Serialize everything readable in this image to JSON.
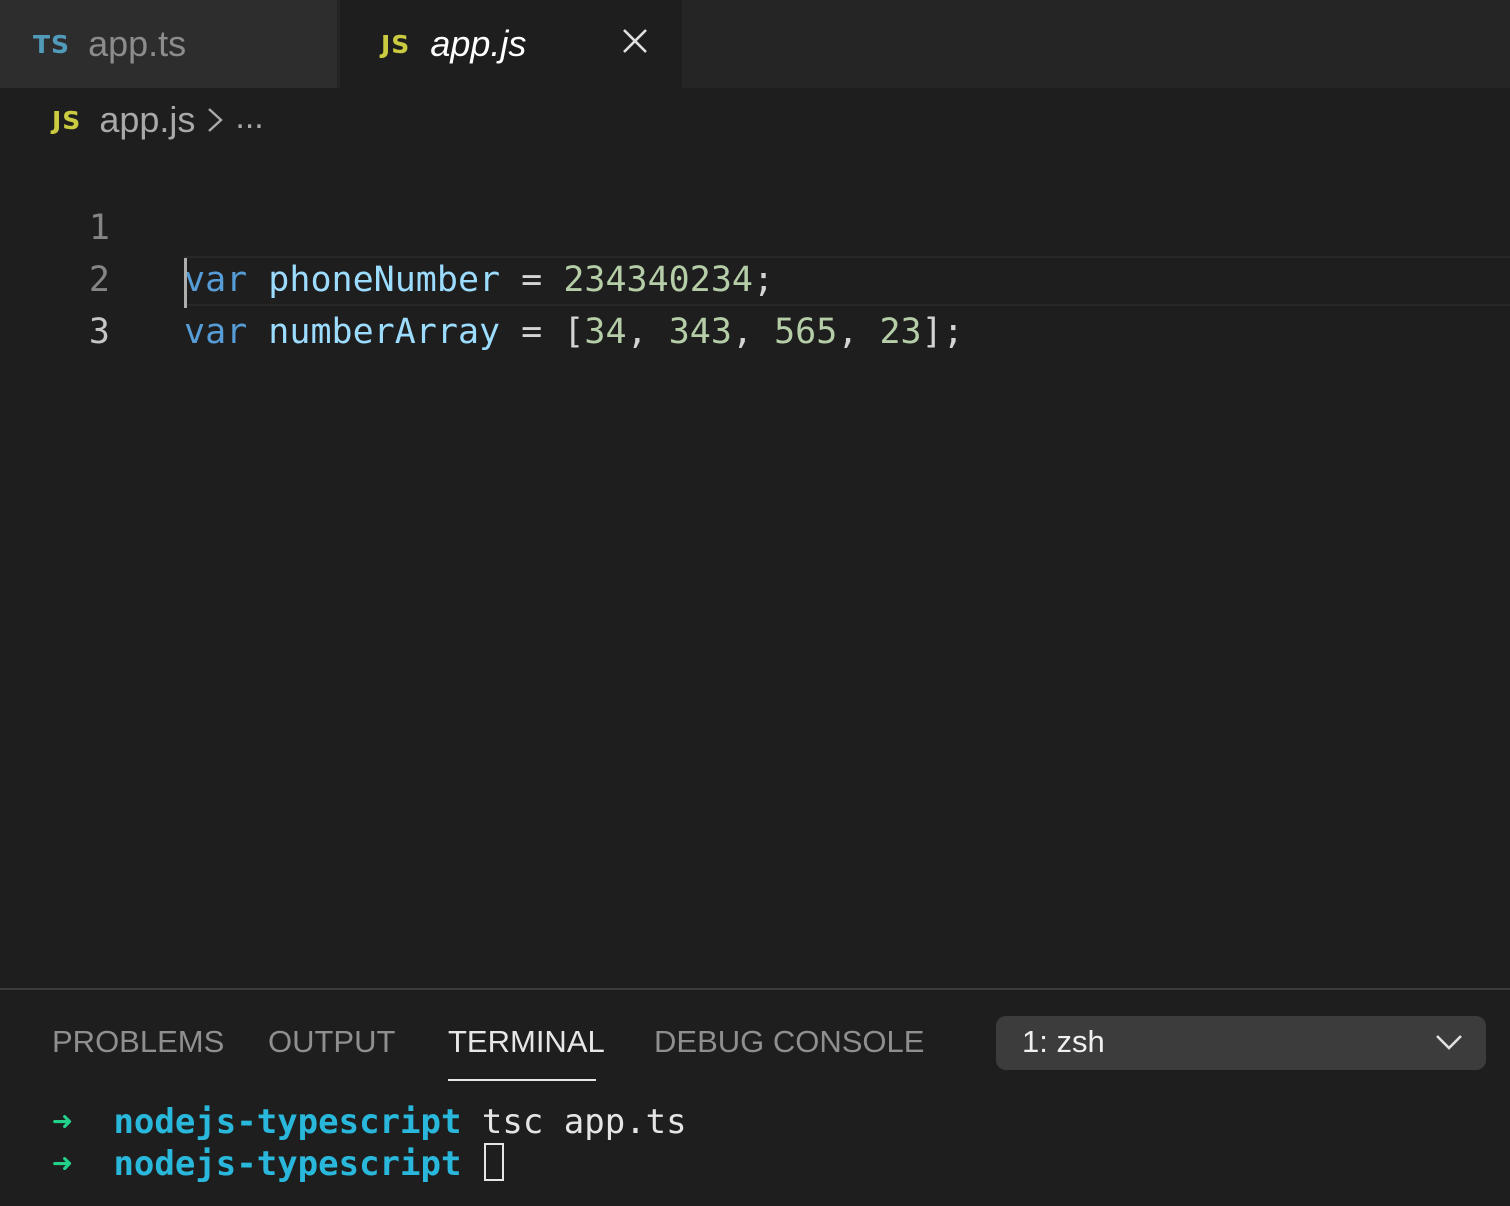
{
  "tabs": [
    {
      "badge": "TS",
      "label": "app.ts",
      "active": false
    },
    {
      "badge": "JS",
      "label": "app.js",
      "active": true
    }
  ],
  "breadcrumb": {
    "badge": "JS",
    "file": "app.js",
    "more": "..."
  },
  "editor": {
    "lines": [
      {
        "number": "1",
        "tokens": {
          "keyword": "var",
          "name": "phoneNumber",
          "eq": "=",
          "value": "234340234",
          "end": ";"
        }
      },
      {
        "number": "2",
        "tokens": {
          "keyword": "var",
          "name": "numberArray",
          "eq": "=",
          "open": "[",
          "v1": "34",
          "v2": "343",
          "v3": "565",
          "v4": "23",
          "comma": ",",
          "end": "];"
        }
      },
      {
        "number": "3"
      }
    ]
  },
  "panel": {
    "tabs": [
      "PROBLEMS",
      "OUTPUT",
      "TERMINAL",
      "DEBUG CONSOLE"
    ],
    "active_tab": "TERMINAL",
    "terminal_select": "1: zsh",
    "terminal": [
      {
        "arrow": "➜",
        "dir": "nodejs-typescript",
        "command": "tsc app.ts"
      },
      {
        "arrow": "➜",
        "dir": "nodejs-typescript",
        "command": ""
      }
    ]
  },
  "icons": {
    "close": "close-icon",
    "breadcrumb_separator": "chevron-right-icon",
    "dropdown": "chevron-down-icon"
  },
  "colors": {
    "editor_bg": "#1e1e1e",
    "keyword": "#569cd6",
    "variable": "#9cdcfe",
    "number": "#b5cea8",
    "ts_badge": "#519aba",
    "js_badge": "#cbcb41",
    "terminal_arrow": "#23d18b",
    "terminal_dir": "#29b8db"
  }
}
